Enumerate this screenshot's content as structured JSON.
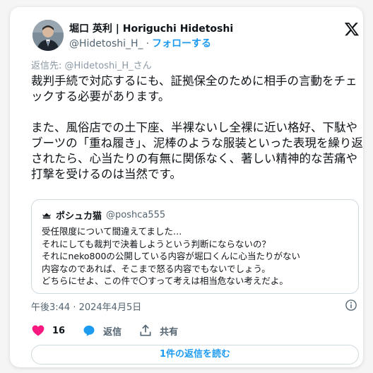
{
  "author": {
    "name": "堀口 英利 | Horiguchi Hidetoshi",
    "handle": "@Hidetoshi_H_",
    "separator": "·",
    "follow_label": "フォローする"
  },
  "reply_to": "返信先: @Hidetoshi_H_さん",
  "tweet": {
    "paragraphs": [
      "裁判手続で対応するにも、証拠保全のために相手の言動をチェックする必要があります。",
      "また、風俗店での土下座、半裸ないし全裸に近い格好、下駄やブーツの「重ね履き」、泥棒のような服装といった表現を繰り返されたら、心当たりの有無に関係なく、著しい精神的な苦痛や打撃を受けるのは当然です。"
    ]
  },
  "quoted_tweet": {
    "name": "ポシュカ猫",
    "handle": "@poshca555",
    "lines": [
      "受任限度について間違えてました…",
      "それにしても裁判で決着しようという判断にならないの？",
      "それにneko800の公開している内容が堀口くんに心当たりがない",
      "内容なのであれば、そこまで怒る内容でもないでしょう。",
      "どちらにせよ、この件で〇すって考えは相当危ない考えだよ。"
    ]
  },
  "timestamp": "午後3:44 · 2024年4月5日",
  "actions": {
    "like_count": "16",
    "reply_label": "返信",
    "share_label": "共有"
  },
  "read_replies_label": "1件の返信を読む",
  "colors": {
    "accent": "#1d9bf0",
    "like": "#f91880",
    "text": "#0f1419",
    "muted": "#536471"
  },
  "icons": [
    "x-logo-icon",
    "cat-icon",
    "info-icon",
    "heart-icon",
    "reply-bubble-icon",
    "share-icon"
  ]
}
